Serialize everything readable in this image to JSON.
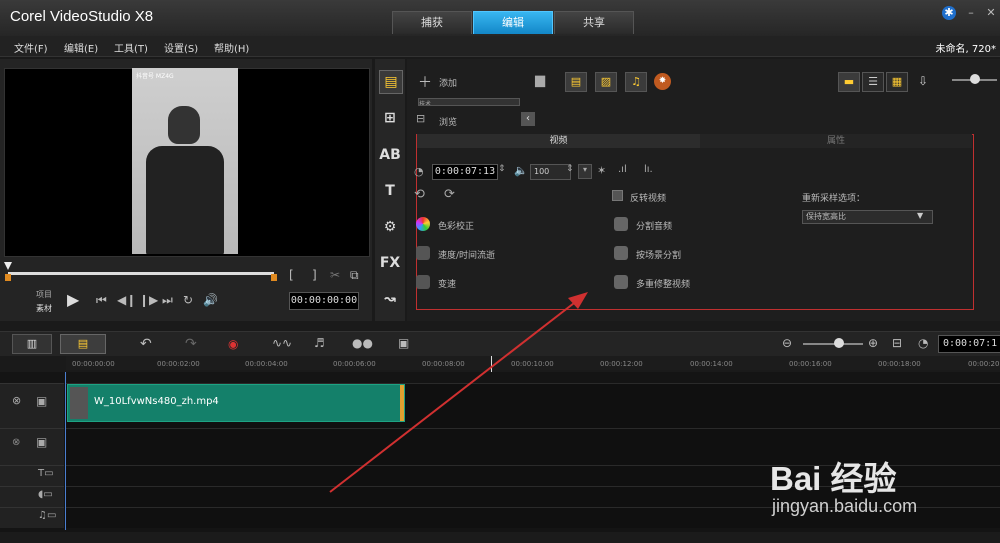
{
  "app": {
    "title": "Corel VideoStudio X8",
    "project_info": "未命名, 720*"
  },
  "tabs": [
    {
      "label": "捕获"
    },
    {
      "label": "编辑"
    },
    {
      "label": "共享"
    }
  ],
  "menu": [
    "文件(F)",
    "编辑(E)",
    "工具(T)",
    "设置(S)",
    "帮助(H)"
  ],
  "preview": {
    "mode_project": "项目",
    "mode_clip": "素材",
    "timecode": "00:00:00:00",
    "frame_text": "抖音号 MZ4G"
  },
  "library": {
    "add_label": "添加",
    "browse_label": "浏览",
    "tab_stub": "技术"
  },
  "options": {
    "tab_video": "视频",
    "tab_properties": "属性",
    "duration": "0:00:07:13",
    "volume": "100",
    "items": {
      "reverse_video": "反转视频",
      "color_correction": "色彩校正",
      "split_audio": "分割音频",
      "speed_time_lapse": "速度/时间流逝",
      "split_by_scene": "按场景分割",
      "variable_speed": "变速",
      "multi_trim": "多重修整视频"
    },
    "resample_label": "重新采样选项：",
    "resample_value": "保持宽高比"
  },
  "timeline": {
    "ruler": [
      "00:00:00:00",
      "00:00:02:00",
      "00:00:04:00",
      "00:00:06:00",
      "00:00:08:00",
      "00:00:10:00",
      "00:00:12:00",
      "00:00:14:00",
      "00:00:16:00",
      "00:00:18:00",
      "00:00:20"
    ],
    "timecode": "0:00:07:1",
    "clip_name": "W_10LfvwNs480_zh.mp4"
  },
  "watermark": {
    "logo": "Bai 经验",
    "url": "jingyan.baidu.com"
  },
  "colors": {
    "accent": "#1f9ee0",
    "clip": "#14806a",
    "highlight_box": "#c03030",
    "arrow": "#d03030"
  }
}
